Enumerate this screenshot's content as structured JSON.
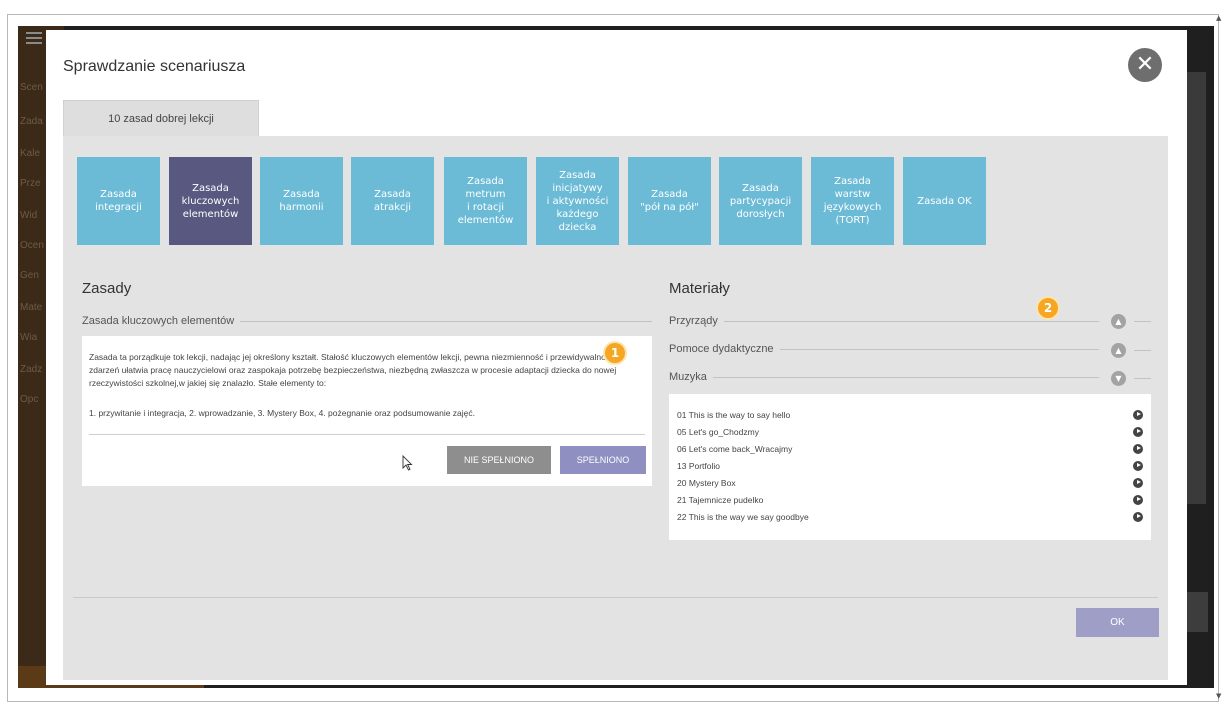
{
  "background": {
    "sidebar_items": [
      "Scen",
      "Zada",
      "Kale",
      "Prze",
      "Wid",
      "Ocen",
      "Gen",
      "Mate",
      "Wia",
      "Zadz",
      "Opc"
    ]
  },
  "modal": {
    "title": "Sprawdzanie scenariusza",
    "close_label": "✕",
    "tab_label": "10 zasad dobrej lekcji",
    "tiles": [
      {
        "label": "Zasada\nintegracji",
        "active": false
      },
      {
        "label": "Zasada\nkluczowych\nelementów",
        "active": true
      },
      {
        "label": "Zasada\nharmonii",
        "active": false
      },
      {
        "label": "Zasada\natrakcji",
        "active": false
      },
      {
        "label": "Zasada\nmetrum\ni rotacji\nelementów",
        "active": false
      },
      {
        "label": "Zasada\ninicjatywy\ni aktywności\nkażdego\ndziecka",
        "active": false
      },
      {
        "label": "Zasada\n\"pół na pół\"",
        "active": false
      },
      {
        "label": "Zasada\npartycypacji\ndorosłych",
        "active": false
      },
      {
        "label": "Zasada\nwarstw\njęzykowych\n(TORT)",
        "active": false
      },
      {
        "label": "Zasada OK",
        "active": false
      }
    ],
    "left": {
      "heading": "Zasady",
      "subheading": "Zasada kluczowych elementów",
      "description": "Zasada ta porządkuje tok lekcji, nadając jej określony kształt. Stałość kluczowych elementów lekcji, pewna niezmienność i przewidywalność zdarzeń ułatwia pracę nauczycielowi oraz zaspokaja potrzebę bezpieczeństwa, niezbędną zwłaszcza w procesie adaptacji dziecka do nowej rzeczywistości szkolnej,w jakiej się znalazło. Stałe elementy to:",
      "list": "1. przywitanie i integracja, 2. wprowadzanie, 3. Mystery Box, 4. pożegnanie oraz podsumowanie zajęć.",
      "btn_not_met": "NIE SPEŁNIONO",
      "btn_met": "SPEŁNIONO",
      "badge": "1"
    },
    "right": {
      "heading": "Materiały",
      "badge": "2",
      "categories": [
        {
          "label": "Przyrządy",
          "state": "collapsed"
        },
        {
          "label": "Pomoce dydaktyczne",
          "state": "collapsed"
        },
        {
          "label": "Muzyka",
          "state": "expanded"
        }
      ],
      "tracks": [
        "01 This is the way to say hello",
        "05 Let's go_Chodzmy",
        "06 Let's come back_Wracajmy",
        "13 Portfolio",
        "20 Mystery Box",
        "21 Tajemnicze pudelko",
        "22 This is the way we say goodbye"
      ]
    },
    "ok_label": "OK"
  }
}
